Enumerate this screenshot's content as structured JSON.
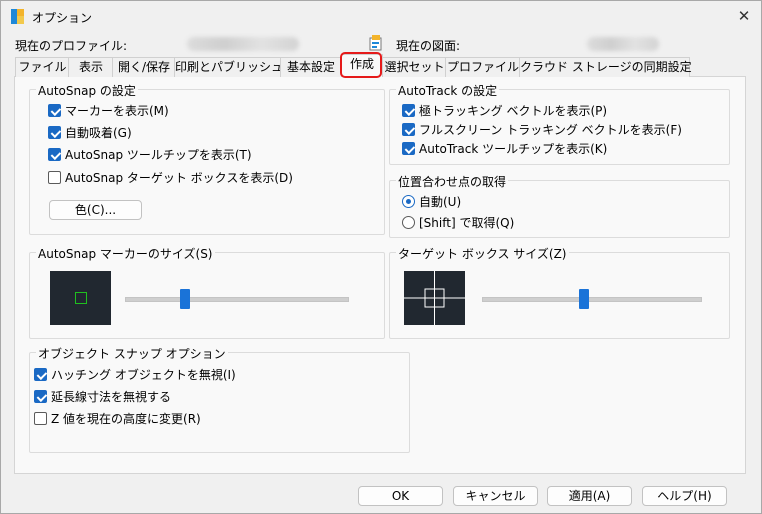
{
  "window": {
    "title": "オプション",
    "close_glyph": "✕"
  },
  "profile": {
    "label": "現在のプロファイル:",
    "drawing_label": "現在の図面:"
  },
  "tabs": [
    {
      "label": "ファイル"
    },
    {
      "label": "表示"
    },
    {
      "label": "開く/保存"
    },
    {
      "label": "印刷とパブリッシュ"
    },
    {
      "label": "基本設定"
    },
    {
      "label": "作成",
      "active": true
    },
    {
      "label": "選択セット"
    },
    {
      "label": "プロファイル"
    },
    {
      "label": "クラウド ストレージの同期設定"
    }
  ],
  "autosnap": {
    "title": "AutoSnap の設定",
    "options": [
      {
        "label": "マーカーを表示(M)",
        "checked": true
      },
      {
        "label": "自動吸着(G)",
        "checked": true
      },
      {
        "label": "AutoSnap ツールチップを表示(T)",
        "checked": true
      },
      {
        "label": "AutoSnap ターゲット ボックスを表示(D)",
        "checked": false
      }
    ],
    "color_button": "色(C)..."
  },
  "autotrack": {
    "title": "AutoTrack の設定",
    "options": [
      {
        "label": "極トラッキング ベクトルを表示(P)",
        "checked": true
      },
      {
        "label": "フルスクリーン トラッキング ベクトルを表示(F)",
        "checked": true
      },
      {
        "label": "AutoTrack ツールチップを表示(K)",
        "checked": true
      }
    ]
  },
  "alignment": {
    "title": "位置合わせ点の取得",
    "options": [
      {
        "label": "自動(U)",
        "selected": true
      },
      {
        "label": "[Shift] で取得(Q)",
        "selected": false
      }
    ]
  },
  "marker_size": {
    "title": "AutoSnap マーカーのサイズ(S)",
    "slider_value": 0.27,
    "marker_color": "#1fc01f"
  },
  "target_box_size": {
    "title": "ターゲット ボックス サイズ(Z)",
    "slider_value": 0.47
  },
  "object_snap": {
    "title": "オブジェクト スナップ オプション",
    "options": [
      {
        "label": "ハッチング オブジェクトを無視(I)",
        "checked": true
      },
      {
        "label": "延長線寸法を無視する",
        "checked": true
      },
      {
        "label": "Z 値を現在の高度に変更(R)",
        "checked": false
      }
    ]
  },
  "buttons": {
    "ok": "OK",
    "cancel": "キャンセル",
    "apply": "適用(A)",
    "help": "ヘルプ(H)"
  },
  "colors": {
    "accent": "#1a69c4",
    "highlight": "#e51a1a",
    "preview_bg": "#212830"
  }
}
